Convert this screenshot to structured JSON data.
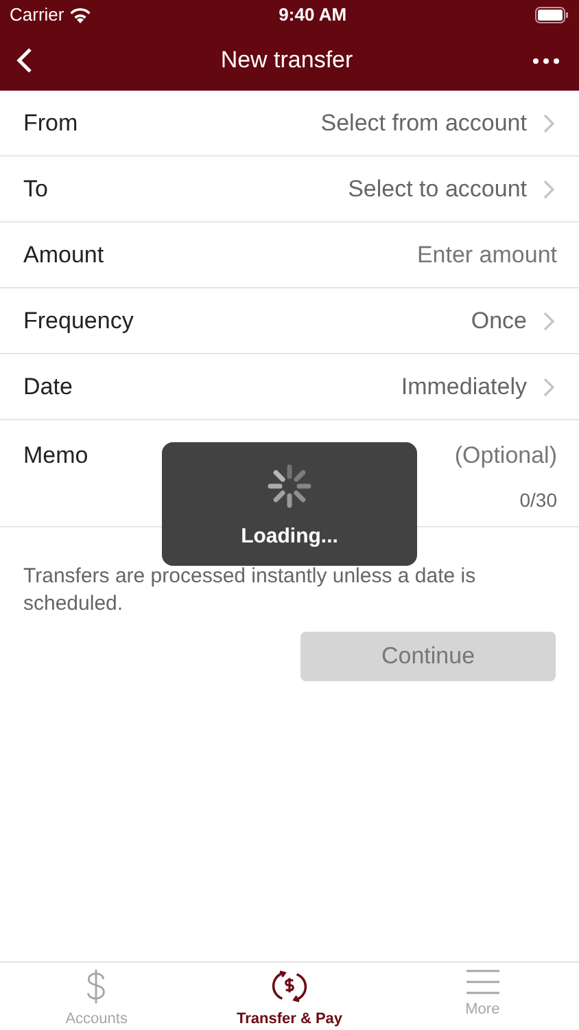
{
  "status_bar": {
    "carrier": "Carrier",
    "time": "9:40 AM"
  },
  "nav": {
    "title": "New transfer"
  },
  "rows": [
    {
      "kind": "picker",
      "label": "From",
      "value": "Select from account"
    },
    {
      "kind": "picker",
      "label": "To",
      "value": "Select to account"
    },
    {
      "kind": "input",
      "label": "Amount",
      "placeholder": "Enter amount"
    },
    {
      "kind": "picker",
      "label": "Frequency",
      "value": "Once"
    },
    {
      "kind": "picker",
      "label": "Date",
      "value": "Immediately"
    },
    {
      "kind": "memo",
      "label": "Memo",
      "placeholder": "(Optional)",
      "counter": "0/30"
    }
  ],
  "note": "Transfers are processed instantly unless a date is scheduled.",
  "continue_button": {
    "label": "Continue",
    "disabled": true
  },
  "loading": {
    "label": "Loading..."
  },
  "tab_bar": [
    {
      "label": "Accounts",
      "kind": "dollar",
      "selected": false
    },
    {
      "label": "Transfer & Pay",
      "kind": "transfer",
      "selected": true
    },
    {
      "label": "More",
      "kind": "menu",
      "selected": false
    }
  ]
}
